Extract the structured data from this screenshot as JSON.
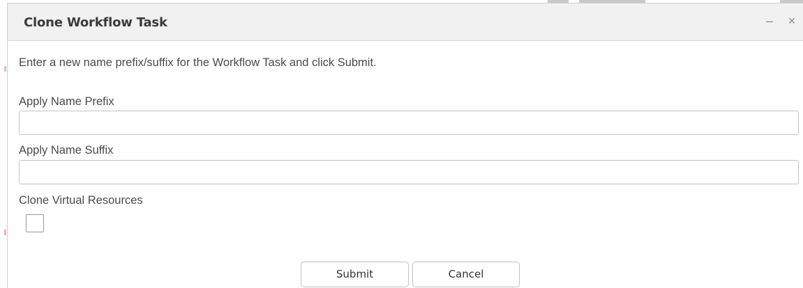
{
  "dialog": {
    "title": "Clone Workflow Task",
    "minimize_glyph": "–",
    "close_glyph": "×",
    "instructions": "Enter a new name prefix/suffix for the Workflow Task and click Submit."
  },
  "fields": {
    "prefix": {
      "label": "Apply Name Prefix",
      "value": "",
      "placeholder": ""
    },
    "suffix": {
      "label": "Apply Name Suffix",
      "value": "",
      "placeholder": ""
    },
    "clone_virtual": {
      "label": "Clone Virtual Resources",
      "checked": false
    }
  },
  "buttons": {
    "submit": "Submit",
    "cancel": "Cancel"
  }
}
